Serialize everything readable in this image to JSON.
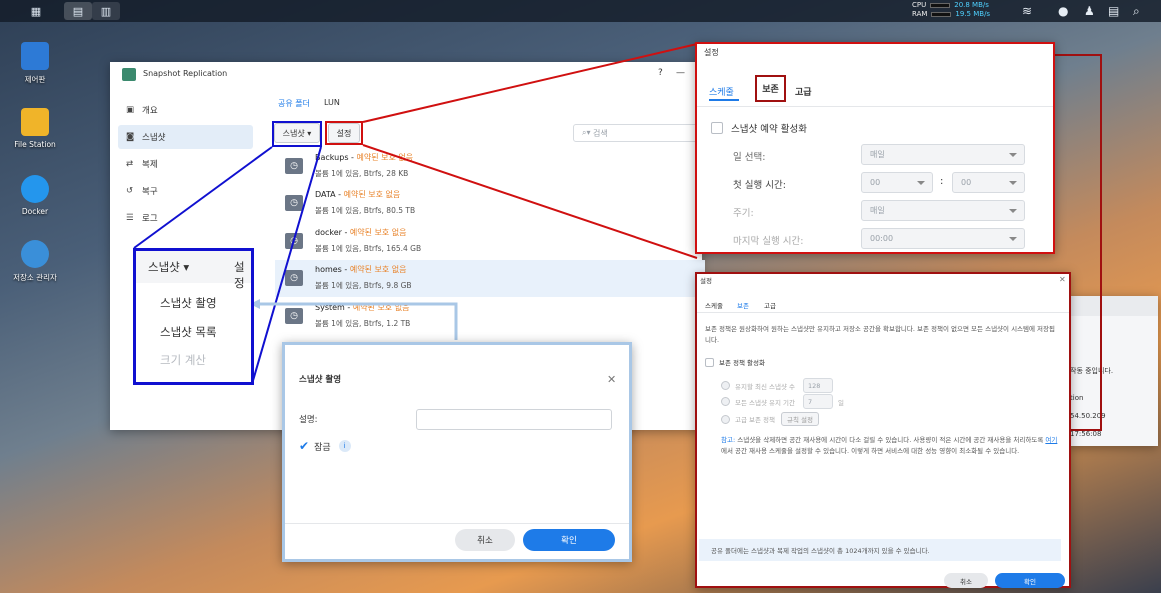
{
  "taskbar": {
    "cpu_label": "CPU",
    "cpu_rate": "20.8 MB/s",
    "ram_label": "RAM",
    "ram_rate": "19.5 MB/s"
  },
  "desktop": [
    "제어판",
    "File Station",
    "Docker",
    "저장소 관리자"
  ],
  "sr": {
    "title": "Snapshot Replication",
    "help": "?",
    "min": "—",
    "side": [
      "개요",
      "스냅샷",
      "복제",
      "복구",
      "로그"
    ],
    "tabs": [
      "공유 폴더",
      "LUN"
    ],
    "snapshot_btn": "스냅샷",
    "settings_btn": "설정",
    "search_placeholder": "검색",
    "folders": [
      {
        "name": "Backups",
        "status": "예약된 보호 없음",
        "sub": "볼륨 1에 있음, Btrfs, 28 KB"
      },
      {
        "name": "DATA",
        "status": "예약된 보호 없음",
        "sub": "볼륨 1에 있음, Btrfs, 80.5 TB"
      },
      {
        "name": "docker",
        "status": "예약된 보호 없음",
        "sub": "볼륨 1에 있음, Btrfs, 165.4 GB"
      },
      {
        "name": "homes",
        "status": "예약된 보호 없음",
        "sub": "볼륨 1에 있음, Btrfs, 9.8 GB"
      },
      {
        "name": "System",
        "status": "예약된 보호 없음",
        "sub": "볼륨 1에 있음, Btrfs, 1.2 TB"
      }
    ]
  },
  "zoom_menu": {
    "snapshot": "스냅샷",
    "settings": "설정",
    "items": [
      "스냅샷 촬영",
      "스냅샷 목록",
      "크기 계산"
    ]
  },
  "take_dialog": {
    "title": "스냅샷 촬영",
    "desc_label": "설명:",
    "lock_label": "잠금",
    "info": "i",
    "cancel": "취소",
    "ok": "확인"
  },
  "sched_panel": {
    "title": "설정",
    "tabs": [
      "스케줄",
      "보존",
      "고급"
    ],
    "enable": "스냅샷 예약 활성화",
    "labels": [
      "일 선택:",
      "첫 실행 시간:",
      "주기:",
      "마지막 실행 시간:"
    ],
    "day": "매일",
    "hour": "00",
    "minute": "00",
    "sep": ":",
    "cycle": "매일",
    "last": "00:00"
  },
  "retain_dlg": {
    "title": "설정",
    "tabs": [
      "스케줄",
      "보존",
      "고급"
    ],
    "intro": "보존 정책은 원상화하여 원하는 스냅샷만 유지하고 저장소 공간을 확보합니다. 보존 정책이 없으면 모든 스냅샷이 시스템에 저장됩니다.",
    "enable": "보존 정책 활성화",
    "opt1": "유지할 최신 스냅샷 수",
    "opt1_val": "128",
    "opt2": "모든 스냅샷 유지 기간",
    "opt2_val": "7",
    "opt2_unit": "일",
    "opt3": "고급 보존 정책",
    "rule_btn": "규칙 설정",
    "note_lbl": "참고:",
    "note": "스냅샷을 삭제하면 공간 재사용에 시간이 다소 걸릴 수 있습니다. 사용량이 적은 시간에 공간 재사용을 처리하도록",
    "note_link": "여기",
    "note2": "에서 공간 재사용 스케줄을 설정할 수 있습니다. 이렇게 하면 서비스에 대한 성능 영향이 최소화될 수 있습니다.",
    "footer": "공유 폴더에는 스냅샷과 복제 작업의 스냅샷이 총 1024개까지 있을 수 있습니다.",
    "cancel": "취소",
    "ok": "확인"
  },
  "bg_win": {
    "line1": "작동 중입니다.",
    "line2": "tion",
    "line3": "54.50.209",
    "line4": "17:56:08"
  }
}
